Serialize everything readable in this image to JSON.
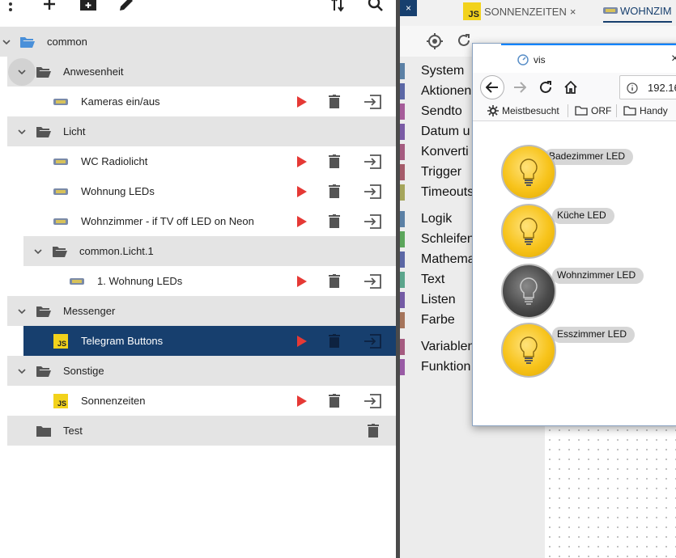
{
  "toolbar": {
    "icons": [
      "more-vert-icon",
      "add-icon",
      "add-folder-icon",
      "edit-icon",
      "sort-icon",
      "search-icon"
    ]
  },
  "tree": {
    "root_label": "common",
    "groups": [
      {
        "label": "Anwesenheit",
        "items": [
          {
            "label": "Kameras ein/aus",
            "type": "scene"
          }
        ]
      },
      {
        "label": "Licht",
        "items": [
          {
            "label": "WC Radiolicht",
            "type": "scene"
          },
          {
            "label": "Wohnung LEDs",
            "type": "scene"
          },
          {
            "label": "Wohnzimmer - if TV off LED on Neon",
            "type": "scene"
          }
        ]
      },
      {
        "label": "common.Licht.1",
        "items": [
          {
            "label": "1. Wohnung LEDs",
            "type": "scene"
          }
        ]
      },
      {
        "label": "Messenger",
        "items": [
          {
            "label": "Telegram Buttons",
            "type": "js",
            "selected": true
          }
        ]
      },
      {
        "label": "Sonstige",
        "items": [
          {
            "label": "Sonnenzeiten",
            "type": "js"
          }
        ]
      },
      {
        "label": "Test",
        "items": []
      }
    ],
    "js_badge": "JS"
  },
  "editor": {
    "tabs": [
      {
        "label": "SONNENZEITEN",
        "close": "×",
        "badge": "JS"
      },
      {
        "label": "WOHNZIM"
      }
    ],
    "blue_close": "×",
    "categories": [
      {
        "label": "System",
        "color": "#5b80a5"
      },
      {
        "label": "Aktionen",
        "color": "#5b67a5"
      },
      {
        "label": "Sendto",
        "color": "#a55b99"
      },
      {
        "label": "Datum u",
        "color": "#7a5ba5"
      },
      {
        "label": "Konverti",
        "color": "#a55b80"
      },
      {
        "label": "Trigger",
        "color": "#a55b6a"
      },
      {
        "label": "Timeouts",
        "color": "#a5a55b"
      },
      {
        "label": "Logik",
        "color": "#5b80a5"
      },
      {
        "label": "Schleifen",
        "color": "#5ba55b"
      },
      {
        "label": "Mathema",
        "color": "#5b67a5"
      },
      {
        "label": "Text",
        "color": "#5ba58c"
      },
      {
        "label": "Listen",
        "color": "#745ba5"
      },
      {
        "label": "Farbe",
        "color": "#a5745b"
      },
      {
        "label": "Variablen",
        "color": "#a55b80"
      },
      {
        "label": "Funktion",
        "color": "#995ba5"
      }
    ]
  },
  "browser": {
    "tab_title": "vis",
    "close": "×",
    "address": "192.16",
    "bookmarks": [
      "Meistbesucht",
      "ORF",
      "Handy"
    ],
    "lights": [
      {
        "label": "Badezimmer LED",
        "on": true
      },
      {
        "label": "Küche LED",
        "on": true
      },
      {
        "label": "Wohnzimmer LED",
        "on": false
      },
      {
        "label": "Esszimmer LED",
        "on": true
      }
    ]
  },
  "colors": {
    "selected_row": "#173f6e",
    "folder_row": "#e4e4e4",
    "run_red": "#e53935",
    "js_yellow": "#f2d21b",
    "folder_blue": "#4a90d9",
    "bulb_on": "#f7c31a"
  }
}
